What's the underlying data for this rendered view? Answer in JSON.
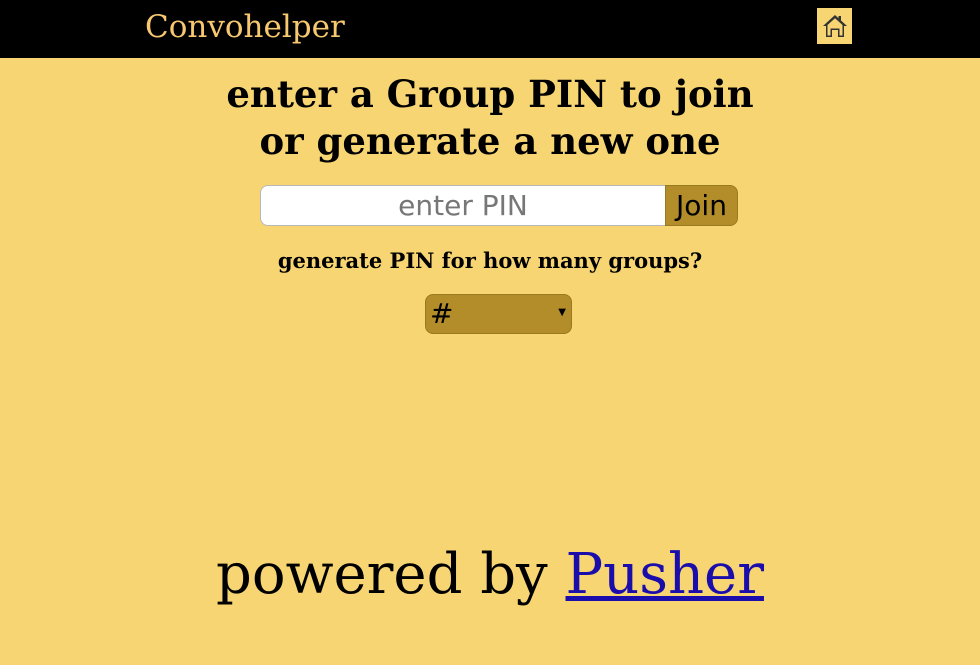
{
  "header": {
    "brand": "Convohelper",
    "home_icon": "home-icon",
    "brand_color": "#f7c86f",
    "background": "#000000"
  },
  "main": {
    "heading_line1": "enter a Group PIN to join",
    "heading_line2": "or generate a new one",
    "pin_input": {
      "placeholder": "enter PIN",
      "value": ""
    },
    "join_label": "Join",
    "groups_prompt": "generate PIN for how many groups?",
    "groups_select": {
      "selected": "#",
      "arrow_icon": "dropdown-arrow-icon"
    }
  },
  "footer": {
    "prefix": "powered by ",
    "link_text": "Pusher"
  },
  "colors": {
    "page_background": "#f7d572",
    "accent": "#b38d2a",
    "link": "#1a0dab"
  }
}
